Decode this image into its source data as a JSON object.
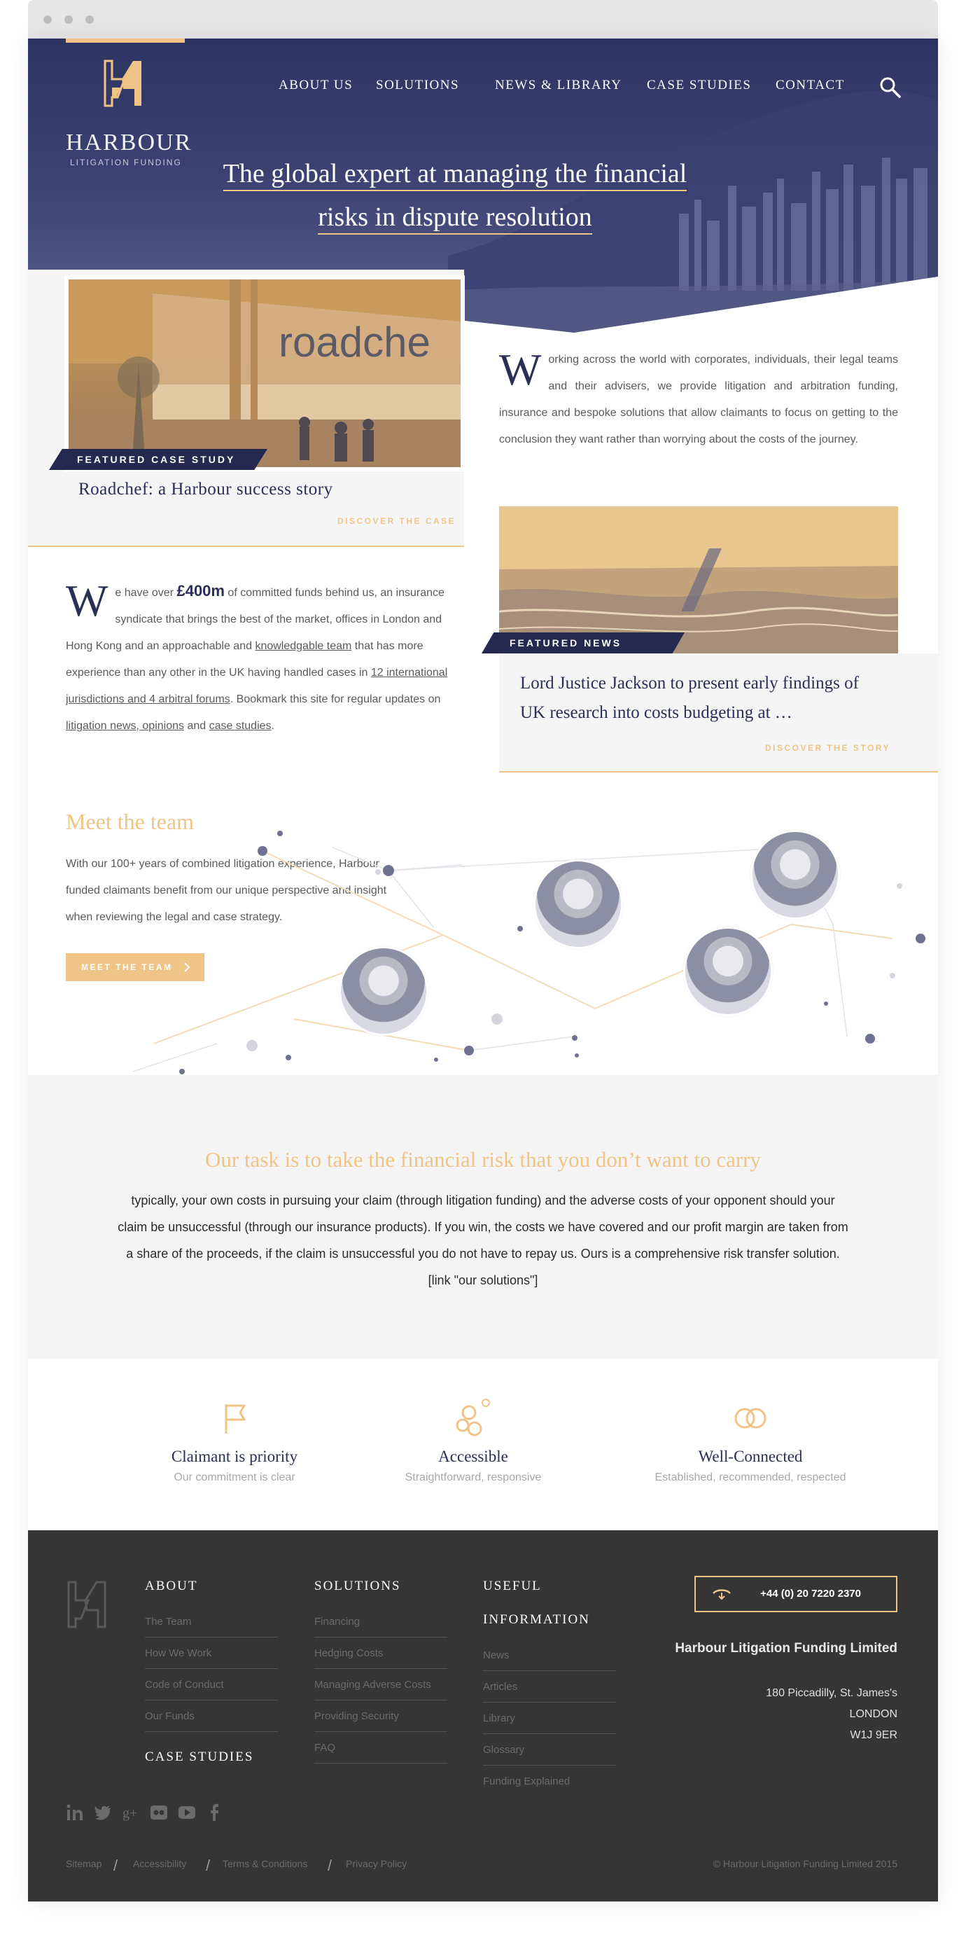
{
  "brand": {
    "name": "HARBOUR",
    "tagline": "LITIGATION FUNDING",
    "accent": "#f0c486",
    "navy": "#2a2f55"
  },
  "nav": {
    "items": [
      "ABOUT US",
      "SOLUTIONS",
      "NEWS & LIBRARY",
      "CASE STUDIES",
      "CONTACT"
    ],
    "search_icon": "search-icon"
  },
  "hero": {
    "line1": "The global expert at managing the financial",
    "line2": "risks in dispute resolution"
  },
  "case_study": {
    "tag": "FEATURED CASE STUDY",
    "sign_text": "roadche",
    "title": "Roadchef: a Harbour success story",
    "link": "DISCOVER THE CASE"
  },
  "intro": {
    "dropcap": "W",
    "text": "orking across the world with corporates, individuals, their legal teams and their advisers, we provide litigation and arbitration funding, insurance and bespoke solutions that allow claimants to focus on getting to the conclusion they want rather than worrying about the costs of the journey."
  },
  "news": {
    "tag": "FEATURED NEWS",
    "title": "Lord Justice Jackson to present early findings of UK research into costs budgeting at …",
    "link": "DISCOVER THE STORY"
  },
  "funds": {
    "dropcap": "W",
    "t1": "e have over ",
    "amount": "£400m",
    "t2": " of committed funds behind us, an insurance syndicate that brings the best of the market, offices in London and Hong Kong and an approachable and ",
    "link1": "knowledgable team",
    "t3": " that has more experience than any other in the UK having handled cases in ",
    "link2": "12 international jurisdictions and 4 arbitral forums",
    "t4": ". Bookmark this site for regular updates on ",
    "link3": "litigation news, opinions",
    "t5": " and ",
    "link4": "case studies",
    "t6": "."
  },
  "team": {
    "title": "Meet the team",
    "text": "With our 100+ years of combined litigation experience, Harbour funded claimants benefit from our unique perspective and insight when reviewing the legal and case strategy.",
    "button": "MEET THE TEAM"
  },
  "task": {
    "title": "Our task is to take the financial risk that you don’t want to carry",
    "text": "typically, your own costs in pursuing your claim (through litigation funding) and the adverse costs of your opponent should your claim be unsuccessful (through our insurance products).  If you win, the costs we have covered and our profit margin are taken from a share of the proceeds, if the claim is unsuccessful you do not have to repay us.  Ours is a comprehensive risk transfer solution. [link \"our solutions\"]"
  },
  "features": [
    {
      "icon": "flag-icon",
      "title": "Claimant is priority",
      "sub": "Our commitment is clear"
    },
    {
      "icon": "bubbles-icon",
      "title": "Accessible",
      "sub": "Straightforward, responsive"
    },
    {
      "icon": "rings-icon",
      "title": "Well-Connected",
      "sub": "Established, recommended, respected"
    }
  ],
  "footer": {
    "about": {
      "heading": "ABOUT",
      "links": [
        "The Team",
        "How We Work",
        "Code of Conduct",
        "Our Funds"
      ]
    },
    "case_studies": "CASE STUDIES",
    "solutions": {
      "heading": "SOLUTIONS",
      "links": [
        "Financing",
        "Hedging Costs",
        "Managing Adverse Costs",
        "Providing Security",
        "FAQ"
      ]
    },
    "useful": {
      "heading1": "USEFUL",
      "heading2": "INFORMATION",
      "links": [
        "News",
        "Articles",
        "Library",
        "Glossary",
        "Funding Explained"
      ]
    },
    "phone": "+44 (0) 20 7220 2370",
    "company": "Harbour Litigation Funding Limited",
    "address": [
      "180 Piccadilly, St. James's",
      "LONDON",
      "W1J 9ER"
    ],
    "social": [
      "linkedin-icon",
      "twitter-icon",
      "googleplus-icon",
      "flickr-icon",
      "youtube-icon",
      "facebook-icon"
    ],
    "legal": [
      "Sitemap",
      "Accessibility",
      "Terms & Conditions",
      "Privacy Policy"
    ],
    "copyright": "© Harbour Litigation Funding Limited 2015"
  }
}
